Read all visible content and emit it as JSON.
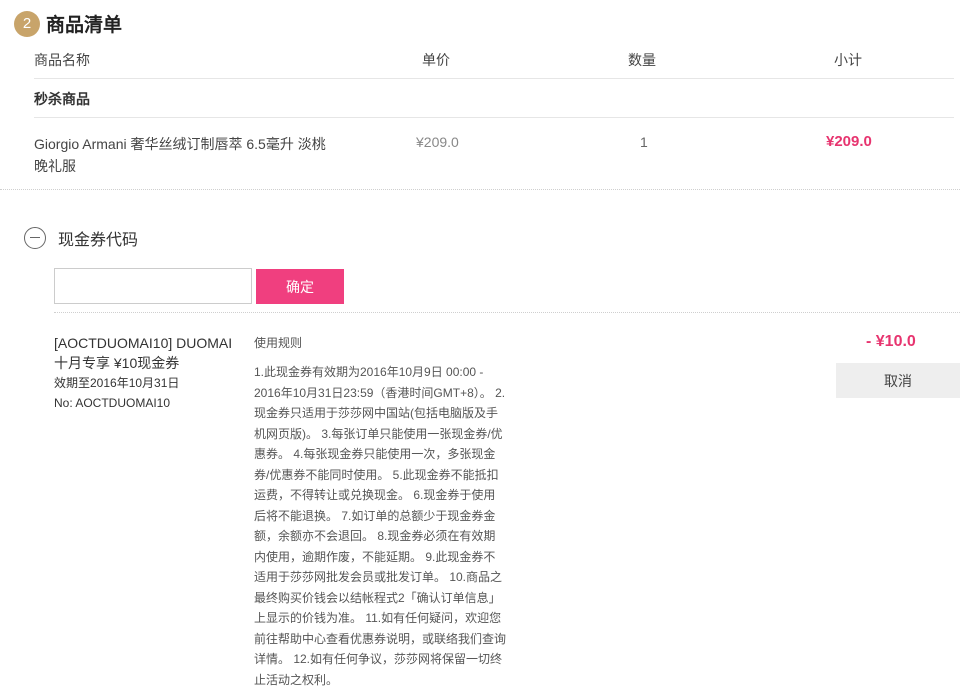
{
  "section": {
    "step": "2",
    "title": "商品清单"
  },
  "table": {
    "headers": {
      "name": "商品名称",
      "price": "单价",
      "qty": "数量",
      "subtotal": "小计"
    },
    "group_label": "秒杀商品",
    "item": {
      "name": "Giorgio Armani 奢华丝绒订制唇萃 6.5毫升 淡桃晚礼服",
      "price": "¥209.0",
      "qty": "1",
      "subtotal": "¥209.0"
    }
  },
  "coupon": {
    "title": "现金券代码",
    "input_value": "",
    "confirm_label": "确定",
    "applied": {
      "name": "[AOCTDUOMAI10] DUOMAI十月专享 ¥10现金券",
      "expiry": "效期至2016年10月31日",
      "code": "No: AOCTDUOMAI10",
      "rules_title": "使用规则",
      "rules_text": "1.此现金券有效期为2016年10月9日 00:00 - 2016年10月31日23:59（香港时间GMT+8）。 2.现金券只适用于莎莎网中国站(包括电脑版及手机网页版)。 3.每张订单只能使用一张现金券/优惠券。 4.每张现金券只能使用一次，多张现金券/优惠券不能同时使用。 5.此现金券不能抵扣运费，不得转让或兑换现金。 6.现金券于使用后将不能退换。 7.如订单的总额少于现金券金额，余额亦不会退回。 8.现金券必须在有效期内使用，逾期作废，不能延期。 9.此现金券不适用于莎莎网批发会员或批发订单。 10.商品之最终购买价钱会以结帐程式2「确认订单信息」上显示的价钱为准。 11.如有任何疑问，欢迎您前往帮助中心查看优惠券说明，或联络我们查询详情。 12.如有任何争议，莎莎网将保留一切终止活动之权利。",
      "discount": "- ¥10.0",
      "cancel_label": "取消"
    }
  }
}
